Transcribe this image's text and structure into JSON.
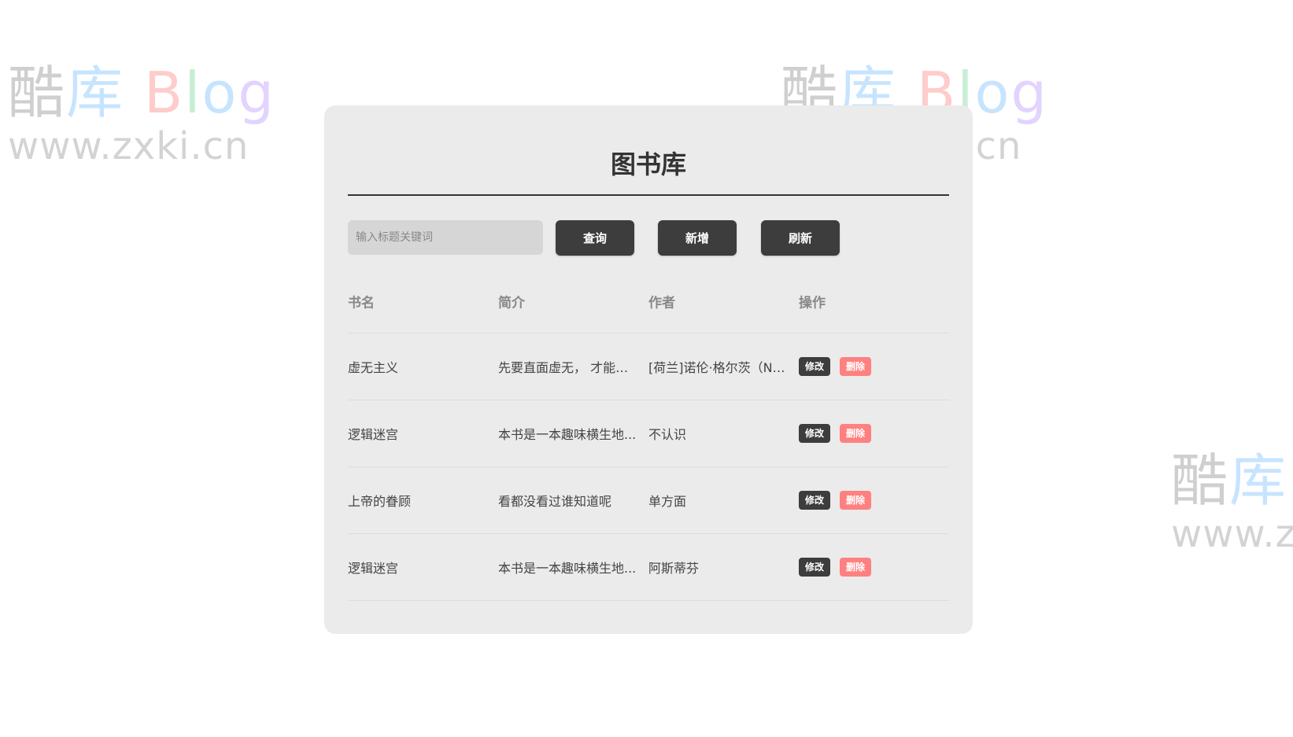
{
  "watermark": {
    "logo_parts": [
      "酷",
      "库",
      "B",
      "l",
      "o",
      "g"
    ],
    "url": "www.zxki.cn"
  },
  "title": "图书库",
  "search": {
    "placeholder": "输入标题关键词",
    "value": ""
  },
  "toolbar": {
    "query_label": "查询",
    "add_label": "新增",
    "refresh_label": "刷新"
  },
  "table": {
    "headers": [
      "书名",
      "简介",
      "作者",
      "操作"
    ],
    "rows": [
      {
        "title": "虚无主义",
        "intro": "先要直面虚无， 才能找...",
        "author": "[荷兰]诺伦·格尔茨（No..."
      },
      {
        "title": "逻辑迷宫",
        "intro": "本书是一本趣味横生地...",
        "author": "不认识"
      },
      {
        "title": "上帝的眷顾",
        "intro": "看都没看过谁知道呢",
        "author": "单方面"
      },
      {
        "title": "逻辑迷宫",
        "intro": "本书是一本趣味横生地...",
        "author": "阿斯蒂芬"
      }
    ],
    "edit_label": "修改",
    "delete_label": "删除"
  },
  "colors": {
    "card_bg": "#ebebeb",
    "button_bg": "#3d3d3d",
    "delete_bg": "#ff8080"
  }
}
